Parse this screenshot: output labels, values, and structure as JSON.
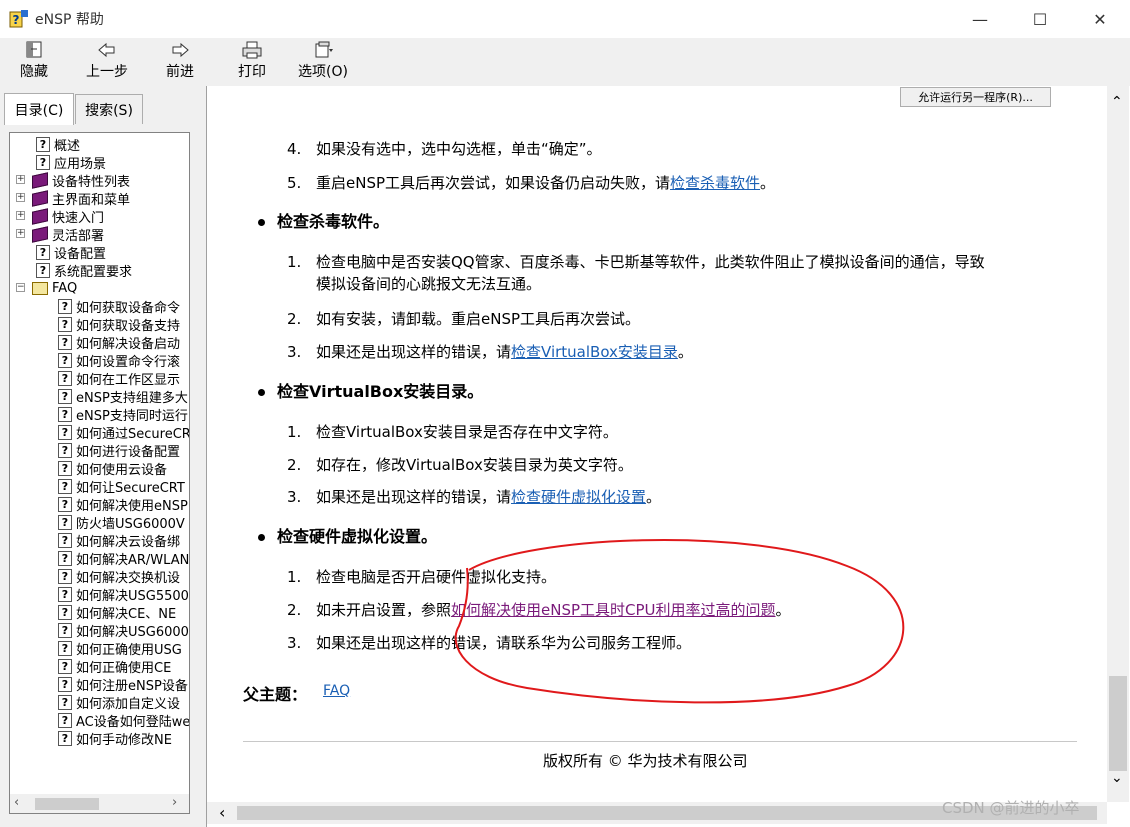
{
  "window": {
    "title": "eNSP 帮助",
    "min_symbol": "—",
    "max_symbol": "☐",
    "close_symbol": "✕"
  },
  "toolbar": {
    "hide_label": "隐藏",
    "back_label": "上一步",
    "forward_label": "前进",
    "print_label": "打印",
    "options_label": "选项(O)"
  },
  "left_tabs": {
    "contents_label": "目录(C)",
    "search_label": "搜索(S)"
  },
  "tree": {
    "items": [
      {
        "label": "概述",
        "icon": "question-page"
      },
      {
        "label": "应用场景",
        "icon": "question-page"
      },
      {
        "label": "设备特性列表",
        "icon": "book"
      },
      {
        "label": "主界面和菜单",
        "icon": "book"
      },
      {
        "label": "快速入门",
        "icon": "book"
      },
      {
        "label": "灵活部署",
        "icon": "book"
      },
      {
        "label": "设备配置",
        "icon": "question-page"
      },
      {
        "label": "系统配置要求",
        "icon": "question-page"
      },
      {
        "label": "FAQ",
        "icon": "book-open"
      }
    ],
    "faq_items": [
      "如何获取设备命令",
      "如何获取设备支持",
      "如何解决设备启动",
      "如何设置命令行滚",
      "如何在工作区显示",
      "eNSP支持组建多大",
      "eNSP支持同时运行",
      "如何通过SecureCR",
      "如何进行设备配置",
      "如何使用云设备",
      "如何让SecureCRT",
      "如何解决使用eNSP",
      "防火墙USG6000V",
      "如何解决云设备绑",
      "如何解决AR/WLAN",
      "如何解决交换机设",
      "如何解决USG5500",
      "如何解决CE、NE",
      "如何解决USG6000",
      "如何正确使用USG",
      "如何正确使用CE",
      "如何注册eNSP设备",
      "如何添加自定义设",
      "AC设备如何登陆web",
      "如何手动修改NE"
    ]
  },
  "content": {
    "top_button": "允许运行另一程序(R)...",
    "step4_num": "4.",
    "step4": "如果没有选中，选中勾选框，单击“确定”。",
    "step5_num": "5.",
    "step5_prefix": "重启eNSP工具后再次尝试，如果设备仍启动失败，请",
    "step5_link": "检查杀毒软件",
    "step5_suffix": "。",
    "h1": "检查杀毒软件。",
    "a1_num": "1.",
    "a1_line1": "检查电脑中是否安装QQ管家、百度杀毒、卡巴斯基等软件，此类软件阻止了模拟设备间的通信，导致",
    "a1_line2": "模拟设备间的心跳报文无法互通。",
    "a2_num": "2.",
    "a2": "如有安装，请卸载。重启eNSP工具后再次尝试。",
    "a3_num": "3.",
    "a3_prefix": "如果还是出现这样的错误，请",
    "a3_link": "检查VirtualBox安装目录",
    "a3_suffix": "。",
    "h2": "检查VirtualBox安装目录。",
    "b1_num": "1.",
    "b1": "检查VirtualBox安装目录是否存在中文字符。",
    "b2_num": "2.",
    "b2": "如存在，修改VirtualBox安装目录为英文字符。",
    "b3_num": "3.",
    "b3_prefix": "如果还是出现这样的错误，请",
    "b3_link": "检查硬件虚拟化设置",
    "b3_suffix": "。",
    "h3": "检查硬件虚拟化设置。",
    "c1_num": "1.",
    "c1": "检查电脑是否开启硬件虚拟化支持。",
    "c2_num": "2.",
    "c2_prefix": "如未开启设置，参照",
    "c2_link": "如何解决使用eNSP工具时CPU利用率过高的问题",
    "c2_suffix": "。",
    "c3_num": "3.",
    "c3": "如果还是出现这样的错误，请联系华为公司服务工程师。",
    "parent_label": "父主题：",
    "parent_link": "FAQ",
    "footer": "版权所有 © 华为技术有限公司"
  },
  "watermark": "CSDN @前进的小卒",
  "colors": {
    "link": "#1a5fb4",
    "visited_link": "#7a1a7a",
    "annotation": "#e0191b"
  }
}
